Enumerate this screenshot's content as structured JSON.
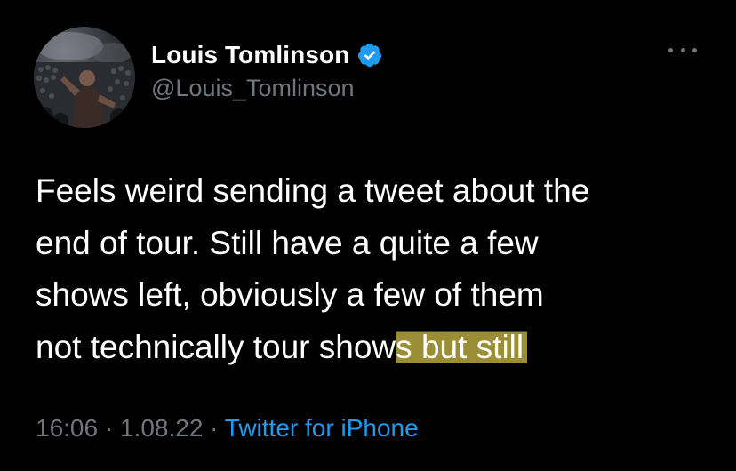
{
  "author": {
    "display_name": "Louis Tomlinson",
    "handle": "@Louis_Tomlinson",
    "verified": true,
    "avatar_icon": "concert-crowd-avatar"
  },
  "actions": {
    "more_icon": "more-options-icon"
  },
  "tweet": {
    "lines": [
      "Feels weird sending a tweet about the",
      "end of tour. Still have a quite a few",
      "shows left, obviously a few of them"
    ],
    "last_line_plain": "not technically tour show",
    "last_line_highlighted": "s but still"
  },
  "meta": {
    "time": "16:06",
    "sep1": " · ",
    "date": "1.08.22",
    "sep2": " · ",
    "source": "Twitter for iPhone"
  },
  "colors": {
    "background": "#000000",
    "text": "#ffffff",
    "secondary": "#71767b",
    "link": "#1d9bf0",
    "verified": "#1d9bf0",
    "highlight": "#d6c44a"
  }
}
